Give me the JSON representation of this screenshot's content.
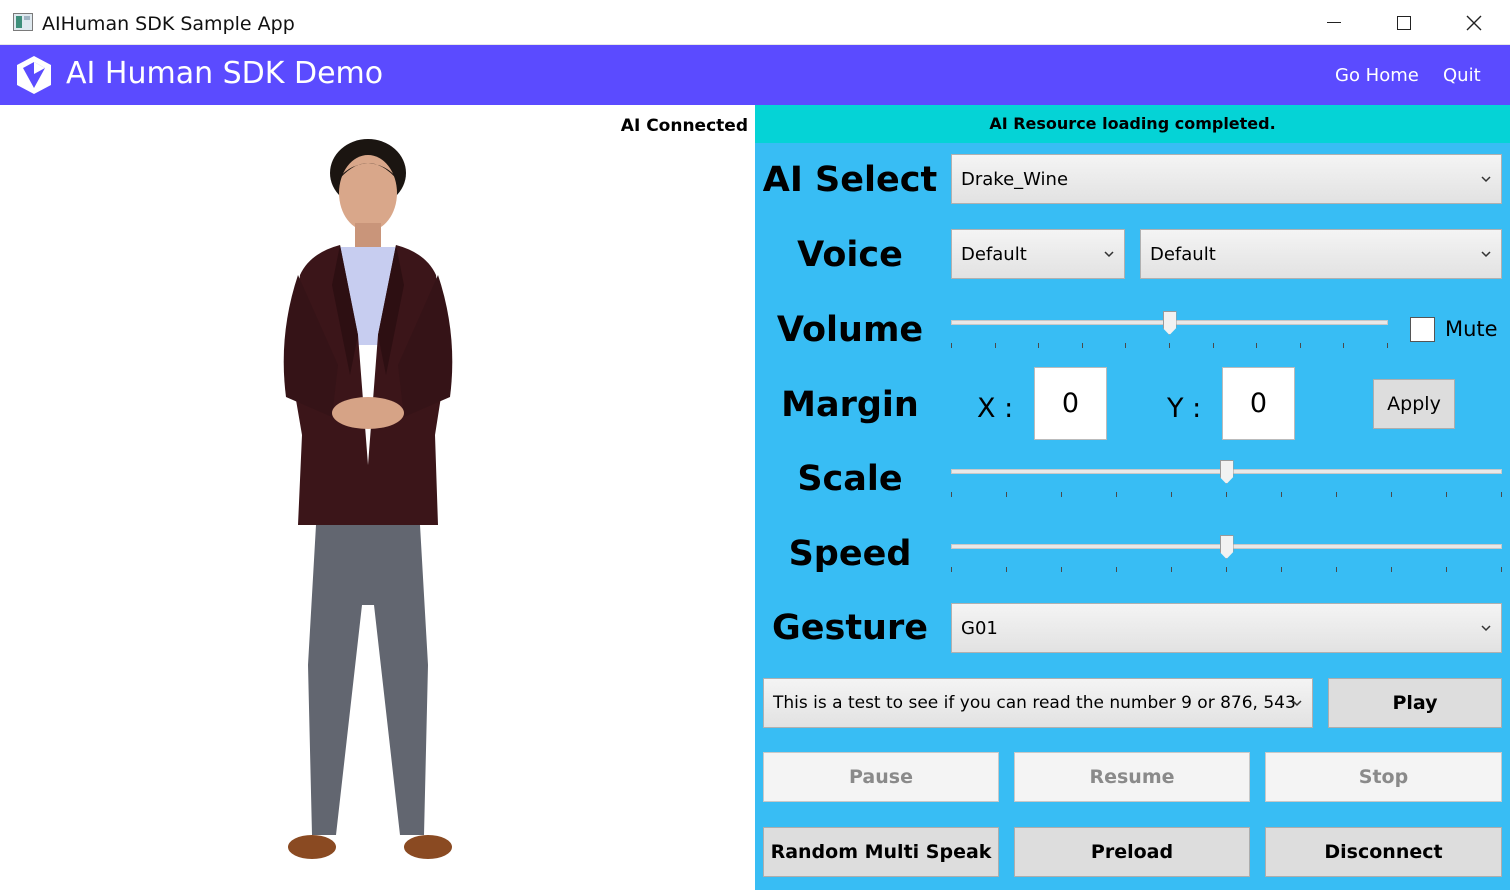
{
  "window": {
    "title": "AIHuman SDK Sample App"
  },
  "header": {
    "title": "AI Human SDK Demo",
    "nav": {
      "home": "Go Home",
      "quit": "Quit"
    }
  },
  "video": {
    "connection_status": "AI Connected"
  },
  "panel": {
    "status": "AI Resource loading completed.",
    "ai_select": {
      "label": "AI Select",
      "value": "Drake_Wine"
    },
    "voice": {
      "label": "Voice",
      "value_1": "Default",
      "value_2": "Default"
    },
    "volume": {
      "label": "Volume",
      "level": 0.5,
      "mute_label": "Mute",
      "muted": false
    },
    "margin": {
      "label": "Margin",
      "x_label": "X :",
      "x_value": "0",
      "y_label": "Y :",
      "y_value": "0",
      "apply_label": "Apply"
    },
    "scale": {
      "label": "Scale",
      "level": 0.5
    },
    "speed": {
      "label": "Speed",
      "level": 0.5
    },
    "gesture": {
      "label": "Gesture",
      "value": "G01"
    },
    "sentence": {
      "value": "This is a test to see if you can read the number 9 or 876, 543"
    },
    "buttons": {
      "play": "Play",
      "pause": "Pause",
      "resume": "Resume",
      "stop": "Stop",
      "random_multi_speak": "Random Multi Speak",
      "preload": "Preload",
      "disconnect": "Disconnect"
    }
  },
  "colors": {
    "accent": "#5b4bff",
    "panel": "#38bdf4",
    "banner": "#05d3d6"
  },
  "icons": {
    "app": "app-window-icon",
    "logo": "cube-logo-icon",
    "dropdown": "chevron-down-icon"
  }
}
